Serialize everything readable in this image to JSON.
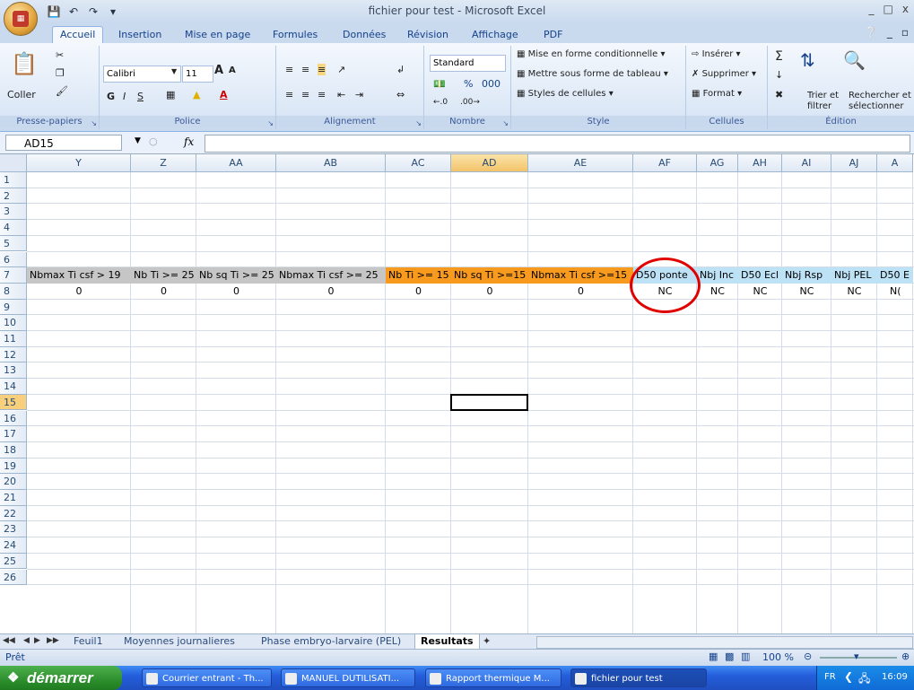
{
  "window": {
    "title": "fichier pour test - Microsoft Excel",
    "controls": [
      "_",
      "□",
      "x"
    ]
  },
  "quick_access": [
    "save-icon",
    "undo-icon",
    "redo-icon",
    "customize-icon"
  ],
  "tabs": [
    "Accueil",
    "Insertion",
    "Mise en page",
    "Formules",
    "Données",
    "Révision",
    "Affichage",
    "PDF"
  ],
  "active_tab": "Accueil",
  "ribbon": {
    "clipboard": {
      "label": "Presse-papiers",
      "paste": "Coller"
    },
    "font": {
      "label": "Police",
      "name": "Calibri",
      "size": "11",
      "bold": "G",
      "italic": "I",
      "underline": "S",
      "grow": "A",
      "shrink": "A"
    },
    "alignment": {
      "label": "Alignement"
    },
    "number": {
      "label": "Nombre",
      "format": "Standard",
      "percent": "%",
      "thousands": "000"
    },
    "style": {
      "label": "Style",
      "conditional": "Mise en forme conditionnelle",
      "table": "Mettre sous forme de tableau",
      "cell_styles": "Styles de cellules"
    },
    "cells": {
      "label": "Cellules",
      "insert": "Insérer",
      "delete": "Supprimer",
      "format": "Format"
    },
    "editing": {
      "label": "Édition",
      "sort": "Trier et filtrer",
      "sort1": "Trier et",
      "sort2": "filtrer",
      "find1": "Rechercher et",
      "find2": "sélectionner"
    }
  },
  "formula_bar": {
    "name_box": "AD15",
    "fx": "fx",
    "formula": ""
  },
  "columns": [
    "Y",
    "Z",
    "AA",
    "AB",
    "AC",
    "AD",
    "AE",
    "AF",
    "AG",
    "AH",
    "AI",
    "AJ",
    "AK"
  ],
  "column_labels": [
    "Y",
    "Z",
    "AA",
    "AB",
    "AC",
    "AD",
    "AE",
    "AF",
    "AG",
    "AH",
    "AI",
    "AJ",
    "A"
  ],
  "selected_column": "AD",
  "rows": [
    "1",
    "2",
    "3",
    "4",
    "5",
    "6",
    "7",
    "8",
    "9",
    "10",
    "11",
    "12",
    "13",
    "14",
    "15",
    "16",
    "17",
    "18",
    "19",
    "20",
    "21",
    "22",
    "23",
    "24",
    "25",
    "26"
  ],
  "selected_row": "15",
  "row7": [
    "Nbmax Ti csf > 19",
    "Nb Ti >= 25",
    "Nb sq Ti >= 25",
    "Nbmax Ti csf >= 25",
    "Nb Ti >= 15",
    "Nb sq Ti >=15",
    "Nbmax Ti csf >=15",
    "D50 ponte",
    "Nbj Inc",
    "D50 Ecl",
    "Nbj Rsp",
    "Nbj PEL",
    "D50 E"
  ],
  "row7_colors": [
    "#c6c6c6",
    "#c6c6c6",
    "#c6c6c6",
    "#c6c6c6",
    "#f79a1e",
    "#f79a1e",
    "#f79a1e",
    "#bde1f5",
    "#bde1f5",
    "#bde1f5",
    "#bde1f5",
    "#bde1f5",
    "#bde1f5"
  ],
  "row8": [
    "0",
    "0",
    "0",
    "0",
    "0",
    "0",
    "0",
    "NC",
    "NC",
    "NC",
    "NC",
    "NC",
    "N("
  ],
  "sheets": [
    "Feuil1",
    "Moyennes journalieres",
    "Phase embryo-larvaire (PEL)",
    "Resultats"
  ],
  "active_sheet": "Resultats",
  "status": {
    "text": "Prêt",
    "zoom": "100 %"
  },
  "taskbar": {
    "start": "démarrer",
    "tasks": [
      "Courrier entrant - Th...",
      "MANUEL DUTILISATI...",
      "Rapport thermique M...",
      "fichier pour test"
    ],
    "active_task": "fichier pour test",
    "lang": "FR",
    "clock": "16:09"
  },
  "annotation": {
    "color": "#e00000",
    "circled_cell": "AF7"
  }
}
